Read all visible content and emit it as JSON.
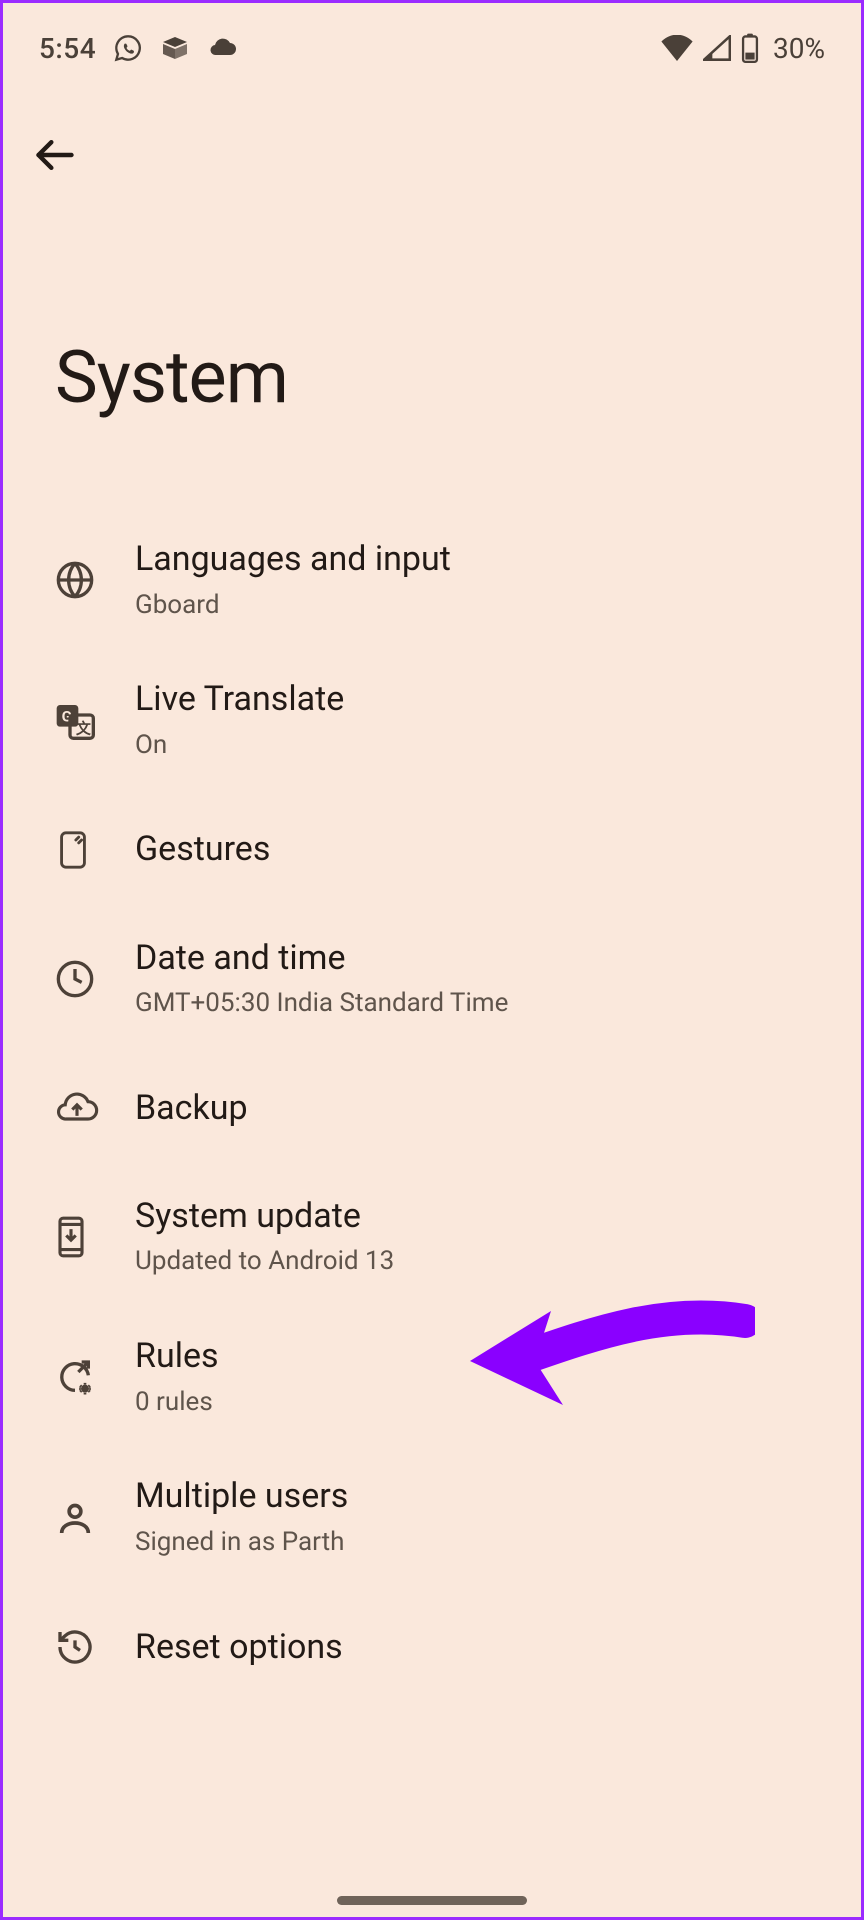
{
  "status": {
    "time": "5:54",
    "battery_text": "30%"
  },
  "page": {
    "title": "System"
  },
  "rows": [
    {
      "title": "Languages and input",
      "sub": "Gboard"
    },
    {
      "title": "Live Translate",
      "sub": "On"
    },
    {
      "title": "Gestures",
      "sub": ""
    },
    {
      "title": "Date and time",
      "sub": "GMT+05:30 India Standard Time"
    },
    {
      "title": "Backup",
      "sub": ""
    },
    {
      "title": "System update",
      "sub": "Updated to Android 13"
    },
    {
      "title": "Rules",
      "sub": "0 rules"
    },
    {
      "title": "Multiple users",
      "sub": "Signed in as Parth"
    },
    {
      "title": "Reset options",
      "sub": ""
    }
  ]
}
